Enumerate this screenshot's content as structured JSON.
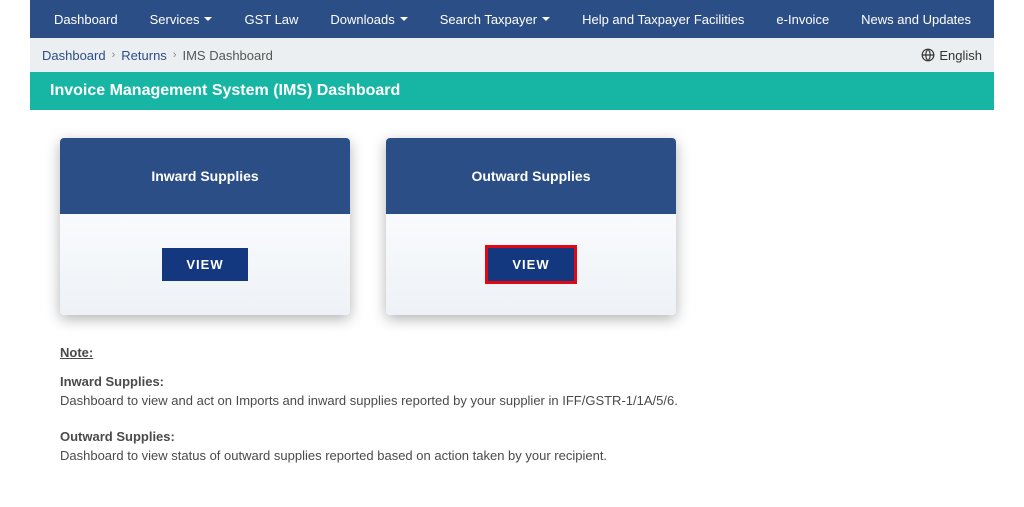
{
  "nav": {
    "items": [
      {
        "label": "Dashboard",
        "dropdown": false
      },
      {
        "label": "Services",
        "dropdown": true
      },
      {
        "label": "GST Law",
        "dropdown": false
      },
      {
        "label": "Downloads",
        "dropdown": true
      },
      {
        "label": "Search Taxpayer",
        "dropdown": true
      },
      {
        "label": "Help and Taxpayer Facilities",
        "dropdown": false
      },
      {
        "label": "e-Invoice",
        "dropdown": false
      },
      {
        "label": "News and Updates",
        "dropdown": false
      }
    ]
  },
  "breadcrumb": {
    "items": [
      "Dashboard",
      "Returns"
    ],
    "current": "IMS Dashboard"
  },
  "language": "English",
  "page_title": "Invoice Management System (IMS) Dashboard",
  "cards": {
    "inward": {
      "title": "Inward Supplies",
      "button": "VIEW"
    },
    "outward": {
      "title": "Outward Supplies",
      "button": "VIEW"
    }
  },
  "notes": {
    "heading": "Note:",
    "inward_title": "Inward Supplies:",
    "inward_text": "Dashboard to view and act on Imports and inward supplies reported by your supplier in IFF/GSTR-1/1A/5/6.",
    "outward_title": "Outward Supplies:",
    "outward_text": "Dashboard to view status of outward supplies reported based on action taken by your recipient."
  }
}
